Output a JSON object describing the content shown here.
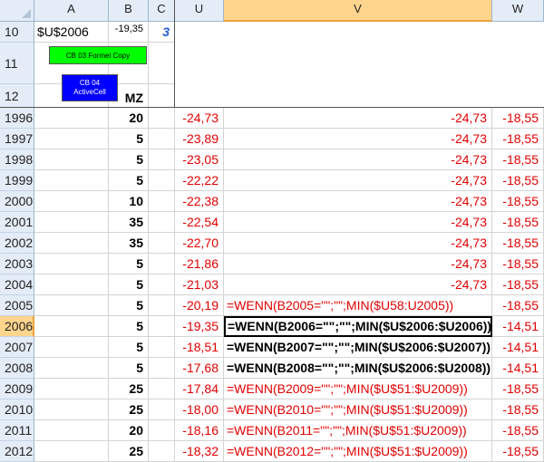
{
  "columns": [
    {
      "id": "corner",
      "label": ""
    },
    {
      "id": "A",
      "label": "A"
    },
    {
      "id": "B",
      "label": "B"
    },
    {
      "id": "C",
      "label": "C"
    },
    {
      "id": "U",
      "label": "U"
    },
    {
      "id": "V",
      "label": "V"
    },
    {
      "id": "W",
      "label": "W"
    }
  ],
  "frozen": {
    "row10": {
      "label": "10",
      "a_text": "$U$2006",
      "b_value": "-19,35",
      "c_value": "3"
    },
    "row11": {
      "label": "11"
    },
    "row12": {
      "label": "12",
      "b_text": "MZ"
    }
  },
  "buttons": {
    "formel_copy": {
      "label": "CB 03 Formel Copy",
      "color": "#00ff00"
    },
    "active_cell": {
      "line1": "CB 04",
      "line2": "ActiveCell",
      "color": "#0000ff"
    }
  },
  "rows": [
    {
      "label": "1996",
      "b": "20",
      "u": "-24,73",
      "v": "-24,73",
      "w": "-18,55"
    },
    {
      "label": "1997",
      "b": "5",
      "u": "-23,89",
      "v": "-24,73",
      "w": "-18,55"
    },
    {
      "label": "1998",
      "b": "5",
      "u": "-23,05",
      "v": "-24,73",
      "w": "-18,55"
    },
    {
      "label": "1999",
      "b": "5",
      "u": "-22,22",
      "v": "-24,73",
      "w": "-18,55"
    },
    {
      "label": "2000",
      "b": "10",
      "u": "-22,38",
      "v": "-24,73",
      "w": "-18,55"
    },
    {
      "label": "2001",
      "b": "35",
      "u": "-22,54",
      "v": "-24,73",
      "w": "-18,55"
    },
    {
      "label": "2002",
      "b": "35",
      "u": "-22,70",
      "v": "-24,73",
      "w": "-18,55"
    },
    {
      "label": "2003",
      "b": "5",
      "u": "-21,86",
      "v": "-24,73",
      "w": "-18,55"
    },
    {
      "label": "2004",
      "b": "5",
      "u": "-21,03",
      "v": "-24,73",
      "w": "-18,55"
    },
    {
      "label": "2005",
      "b": "5",
      "u": "-20,19",
      "v": "=WENN(B2005=\"\";\"\";MIN($U58:U2005))",
      "w": "-18,55"
    },
    {
      "label": "2006",
      "b": "5",
      "u": "-19,35",
      "v": "=WENN(B2006=\"\";\"\";MIN($U$2006:$U2006))",
      "w": "-14,51"
    },
    {
      "label": "2007",
      "b": "5",
      "u": "-18,51",
      "v": "=WENN(B2007=\"\";\"\";MIN($U$2006:$U2007))",
      "w": "-14,51"
    },
    {
      "label": "2008",
      "b": "5",
      "u": "-17,68",
      "v": "=WENN(B2008=\"\";\"\";MIN($U$2006:$U2008))",
      "w": "-14,51"
    },
    {
      "label": "2009",
      "b": "25",
      "u": "-17,84",
      "v": "=WENN(B2009=\"\";\"\";MIN($U$51:$U2009))",
      "w": "-18,55"
    },
    {
      "label": "2010",
      "b": "25",
      "u": "-18,00",
      "v": "=WENN(B2010=\"\";\"\";MIN($U$51:$U2009))",
      "w": "-18,55"
    },
    {
      "label": "2011",
      "b": "20",
      "u": "-18,16",
      "v": "=WENN(B2011=\"\";\"\";MIN($U$51:$U2009))",
      "w": "-18,55"
    },
    {
      "label": "2012",
      "b": "25",
      "u": "-18,32",
      "v": "=WENN(B2012=\"\";\"\";MIN($U$51:$U2009))",
      "w": "-18,55"
    }
  ],
  "selection": {
    "row": "2006",
    "column": "V"
  },
  "colors": {
    "red_text": "#e00000",
    "header_bg": "#e4ecf7",
    "selected_header_bg": "#ffd58d",
    "accent_blue": "#1f5fcf"
  }
}
